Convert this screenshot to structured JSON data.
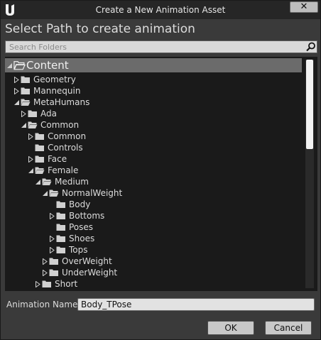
{
  "window": {
    "title": "Create a New Animation Asset",
    "close_label": "✕"
  },
  "heading": "Select Path to create animation",
  "search": {
    "placeholder": "Search Folders",
    "value": ""
  },
  "tree": [
    {
      "label": "Content",
      "depth": 0,
      "arrow": "expanded",
      "selected": true
    },
    {
      "label": "Geometry",
      "depth": 1,
      "arrow": "collapsed"
    },
    {
      "label": "Mannequin",
      "depth": 1,
      "arrow": "collapsed"
    },
    {
      "label": "MetaHumans",
      "depth": 1,
      "arrow": "expanded"
    },
    {
      "label": "Ada",
      "depth": 2,
      "arrow": "collapsed"
    },
    {
      "label": "Common",
      "depth": 2,
      "arrow": "expanded"
    },
    {
      "label": "Common",
      "depth": 3,
      "arrow": "collapsed"
    },
    {
      "label": "Controls",
      "depth": 3,
      "arrow": "none"
    },
    {
      "label": "Face",
      "depth": 3,
      "arrow": "collapsed"
    },
    {
      "label": "Female",
      "depth": 3,
      "arrow": "expanded"
    },
    {
      "label": "Medium",
      "depth": 4,
      "arrow": "expanded"
    },
    {
      "label": "NormalWeight",
      "depth": 5,
      "arrow": "expanded"
    },
    {
      "label": "Body",
      "depth": 6,
      "arrow": "none"
    },
    {
      "label": "Bottoms",
      "depth": 6,
      "arrow": "collapsed"
    },
    {
      "label": "Poses",
      "depth": 6,
      "arrow": "none"
    },
    {
      "label": "Shoes",
      "depth": 6,
      "arrow": "collapsed"
    },
    {
      "label": "Tops",
      "depth": 6,
      "arrow": "collapsed"
    },
    {
      "label": "OverWeight",
      "depth": 5,
      "arrow": "collapsed"
    },
    {
      "label": "UnderWeight",
      "depth": 5,
      "arrow": "collapsed"
    },
    {
      "label": "Short",
      "depth": 4,
      "arrow": "collapsed"
    }
  ],
  "animation_name": {
    "label": "Animation Name",
    "value": "Body_TPose"
  },
  "buttons": {
    "ok": "OK",
    "cancel": "Cancel"
  },
  "colors": {
    "background": "#3a3a3a",
    "tree_background": "#1a1a1a",
    "selected_row": "#6b6b6b",
    "folder": "#d0d0d0"
  },
  "icons": {
    "logo": "unreal-logo-icon",
    "search": "search-icon",
    "folder": "folder-icon",
    "folder_open": "folder-open-icon"
  }
}
